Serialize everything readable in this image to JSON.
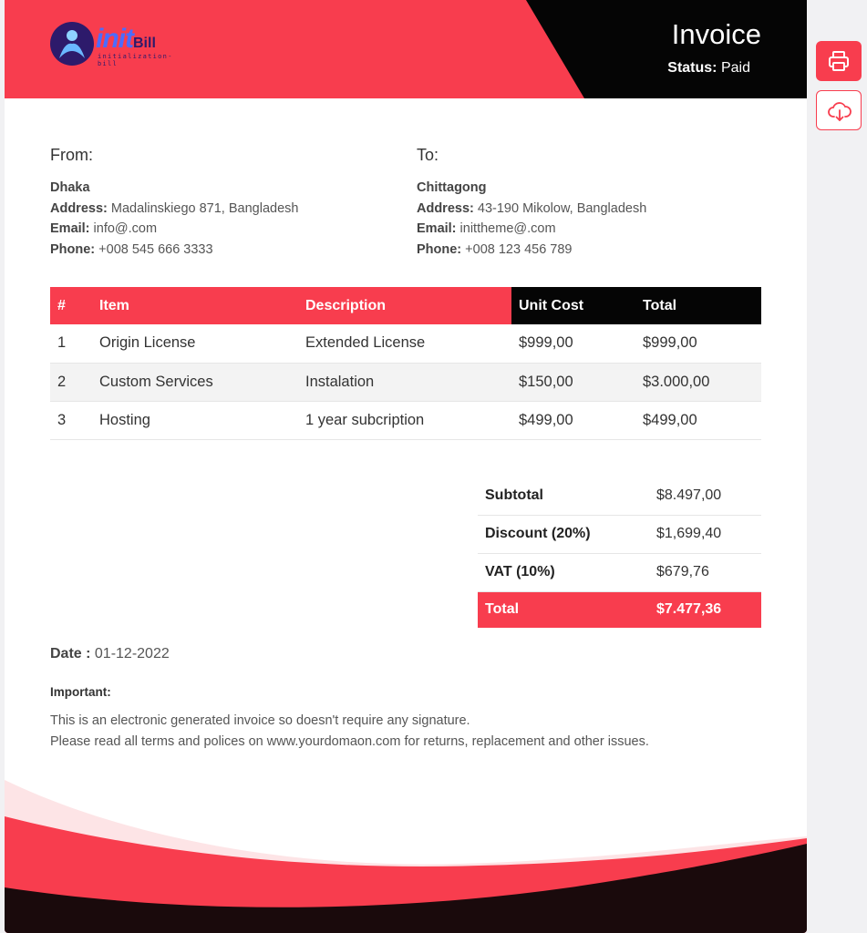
{
  "brand": {
    "logo_text_1": "init",
    "logo_text_2": "Bill",
    "tagline": "initialization-bill"
  },
  "header": {
    "title": "Invoice",
    "status_label": "Status:",
    "status_value": "Paid"
  },
  "from": {
    "heading": "From:",
    "name": "Dhaka",
    "address_label": "Address:",
    "address": "Madalinskiego 871, Bangladesh",
    "email_label": "Email:",
    "email": "info@.com",
    "phone_label": "Phone:",
    "phone": "+008 545 666 3333"
  },
  "to": {
    "heading": "To:",
    "name": "Chittagong",
    "address_label": "Address:",
    "address": "43-190 Mikolow, Bangladesh",
    "email_label": "Email:",
    "email": "inittheme@.com",
    "phone_label": "Phone:",
    "phone": "+008 123 456 789"
  },
  "items_table": {
    "headers": [
      "#",
      "Item",
      "Description",
      "Unit Cost",
      "Total"
    ],
    "rows": [
      [
        "1",
        "Origin License",
        "Extended License",
        "$999,00",
        "$999,00"
      ],
      [
        "2",
        "Custom Services",
        "Instalation",
        "$150,00",
        "$3.000,00"
      ],
      [
        "3",
        "Hosting",
        "1 year subcription",
        "$499,00",
        "$499,00"
      ]
    ]
  },
  "totals": {
    "subtotal_label": "Subtotal",
    "subtotal": "$8.497,00",
    "discount_label": "Discount (20%)",
    "discount": "$1,699,40",
    "vat_label": "VAT (10%)",
    "vat": "$679,76",
    "total_label": "Total",
    "total": "$7.477,36"
  },
  "date": {
    "label": "Date :",
    "value": "01-12-2022"
  },
  "important_label": "Important:",
  "notes": [
    "This is an electronic generated invoice so doesn't require any signature.",
    "Please read all terms and polices on www.yourdomaon.com for returns, replacement and other issues."
  ],
  "actions": {
    "print_icon": "printer-icon",
    "download_icon": "cloud-download-icon"
  },
  "colors": {
    "accent": "#f83d4e",
    "dark": "#050505",
    "footer_dark": "#1a0a0c",
    "footer_light": "#fde4e6"
  }
}
